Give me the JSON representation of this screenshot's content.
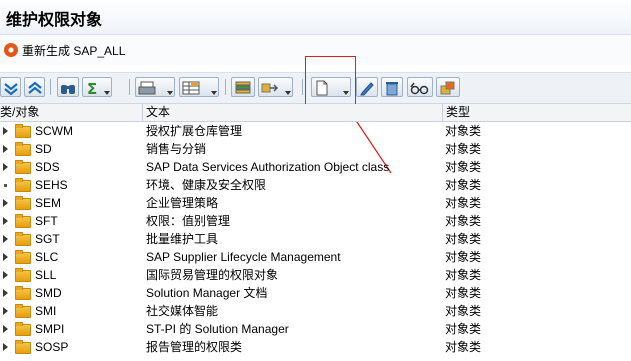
{
  "window": {
    "title": "维护权限对象"
  },
  "appbar": {
    "regenerate_label": "重新生成 SAP_ALL"
  },
  "toolbar": {
    "buttons": [
      "expand-all",
      "collapse-all",
      "find",
      "sum",
      "print",
      "layout",
      "export",
      "create",
      "edit",
      "delete",
      "where-used",
      "transport"
    ]
  },
  "table": {
    "headers": {
      "object": "类/对象",
      "text": "文本",
      "type": "类型"
    },
    "rows": [
      {
        "name": "SCWM",
        "desc": "授权扩展仓库管理",
        "type": "对象类"
      },
      {
        "name": "SD",
        "desc": "销售与分销",
        "type": "对象类"
      },
      {
        "name": "SDS",
        "desc": "SAP Data Services Authorization Object class",
        "type": "对象类"
      },
      {
        "name": "SEHS",
        "desc": "环境、健康及安全权限",
        "type": "对象类"
      },
      {
        "name": "SEM",
        "desc": "企业管理策略",
        "type": "对象类"
      },
      {
        "name": "SFT",
        "desc": "权限：值别管理",
        "type": "对象类"
      },
      {
        "name": "SGT",
        "desc": "批量维护工具",
        "type": "对象类"
      },
      {
        "name": "SLC",
        "desc": "SAP Supplier Lifecycle Management",
        "type": "对象类"
      },
      {
        "name": "SLL",
        "desc": "国际贸易管理的权限对象",
        "type": "对象类"
      },
      {
        "name": "SMD",
        "desc": "Solution Manager 文档",
        "type": "对象类"
      },
      {
        "name": "SMI",
        "desc": "社交媒体智能",
        "type": "对象类"
      },
      {
        "name": "SMPI",
        "desc": "ST-PI 的 Solution Manager",
        "type": "对象类"
      },
      {
        "name": "SOSP",
        "desc": "报告管理的权限类",
        "type": "对象类"
      }
    ]
  },
  "colors": {
    "annotation": "#e02020",
    "folder": "#f0b020"
  }
}
